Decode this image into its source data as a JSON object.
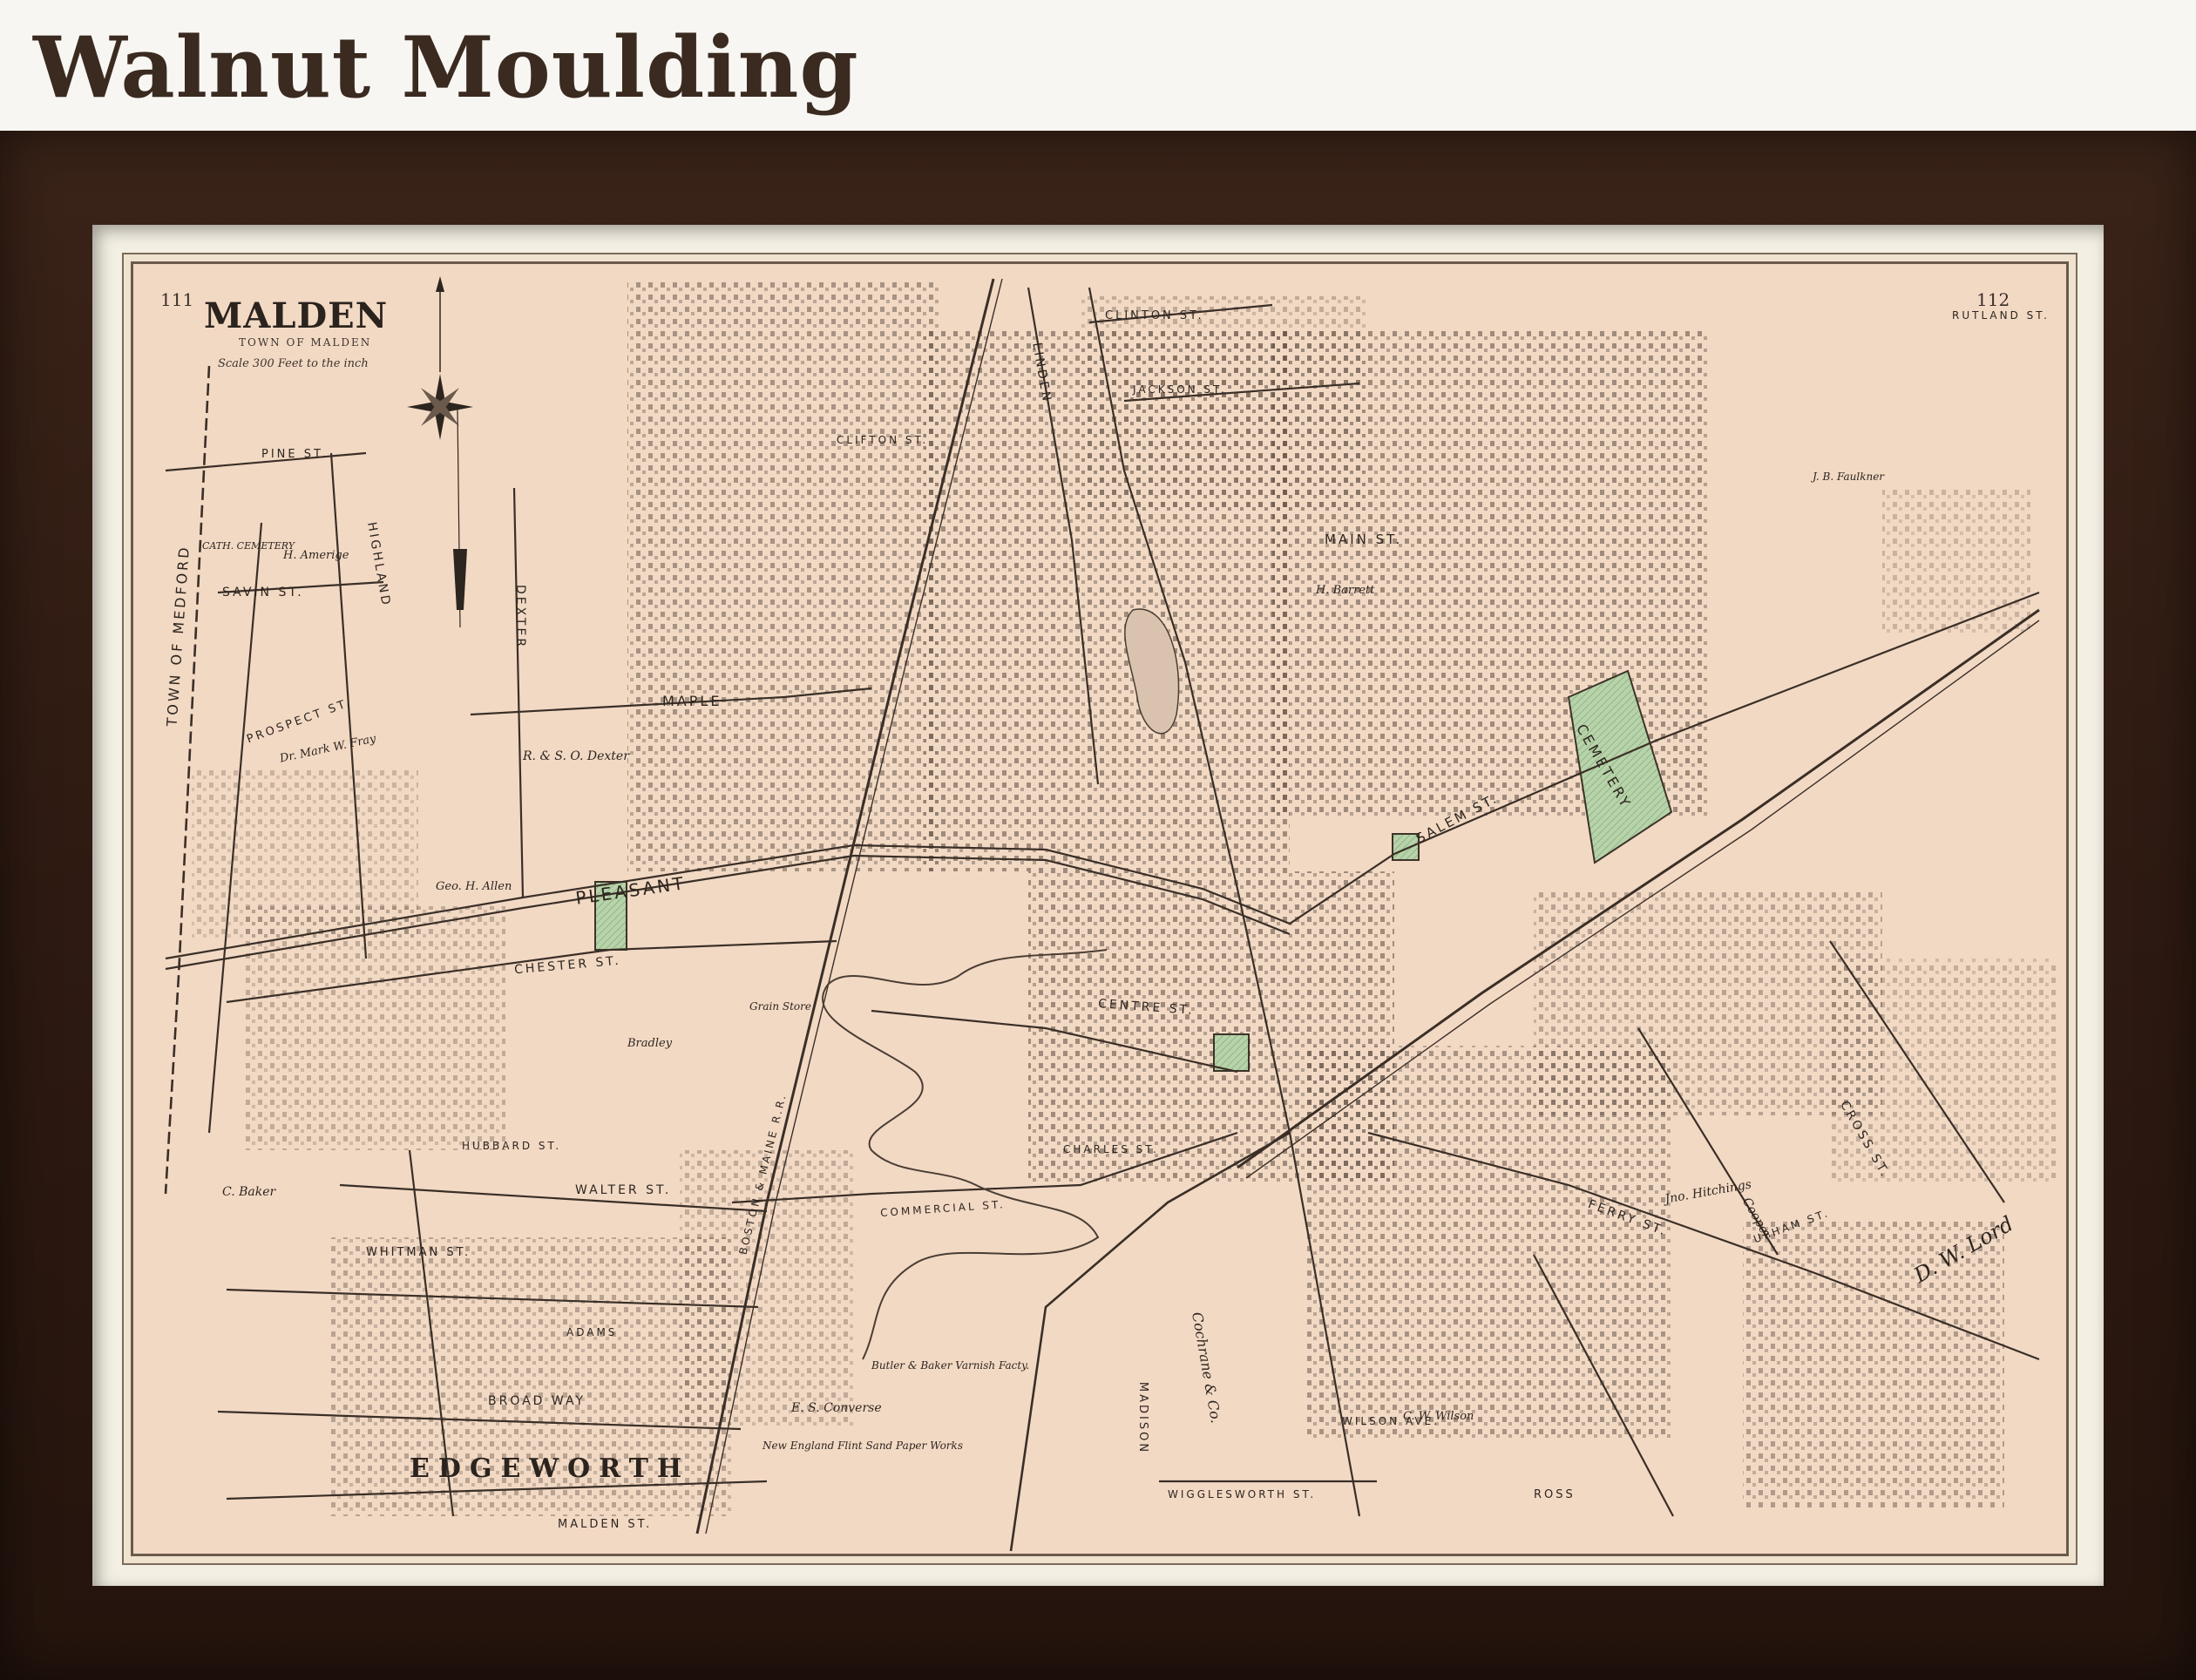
{
  "header": {
    "title": "Walnut Moulding"
  },
  "map": {
    "title": "MALDEN",
    "subtitle": "TOWN OF MALDEN",
    "scale": "Scale 300 Feet to the inch",
    "page_left": "111",
    "page_right": "112",
    "colors": {
      "paper": "#f2d9c4",
      "park_green": "#b7d3a9",
      "ink": "#2d251f",
      "frame_walnut": "#2e1a12"
    },
    "streets": {
      "pleasant": "PLEASANT",
      "chester": "CHESTER ST.",
      "maple": "MAPLE",
      "dexter": "DEXTER",
      "savin": "SAVIN ST.",
      "pine": "PINE ST.",
      "highland": "HIGHLAND",
      "prospect": "PROSPECT ST.",
      "walter": "WALTER ST.",
      "whitman": "WHITMAN ST.",
      "broadway": "BROAD WAY",
      "adams": "ADAMS",
      "hubbard": "HUBBARD ST.",
      "malden_st": "MALDEN ST.",
      "centre": "CENTRE ST.",
      "salem": "SALEM ST.",
      "main": "MAIN ST.",
      "linden": "LINDEN",
      "clinton": "CLINTON ST.",
      "clifton": "CLIFTON ST.",
      "jackson": "JACKSON ST.",
      "cross": "CROSS ST.",
      "ferry": "FERRY ST.",
      "charles": "CHARLES ST.",
      "commercial": "COMMERCIAL ST.",
      "madison": "MADISON",
      "wigglesworth": "WIGGLESWORTH ST.",
      "wilson": "WILSON AVE.",
      "rutland": "RUTLAND ST.",
      "ross": "ROSS",
      "upham": "UPHAM ST.",
      "town_of_medford": "TOWN OF MEDFORD",
      "boston_maine": "BOSTON & MAINE R.R."
    },
    "labels": {
      "cemetery": "CEMETERY",
      "edgeworth": "EDGEWORTH",
      "cath_cemetery": "CATH. CEMETERY",
      "sand_paper": "New England Flint Sand Paper Works",
      "butler_baker": "Butler & Baker Varnish Facty.",
      "cochrane": "Cochrane & Co.",
      "dw_lord": "D. W. Lord",
      "dexter_owner": "R. & S. O. Dexter",
      "mark_fray": "Dr. Mark W. Fray",
      "converse": "E. S. Converse",
      "baker": "C. Baker",
      "ameridge": "H. Amerige",
      "jno_hitchings": "Jno. Hitchings",
      "cw_wilson": "C. W. Wilson",
      "faulkner": "J. B. Faulkner",
      "barrett": "H. Barrett",
      "allen": "Geo. H. Allen",
      "bradley": "Bradley",
      "cooper": "Cooper",
      "grain_store": "Grain Store"
    }
  }
}
